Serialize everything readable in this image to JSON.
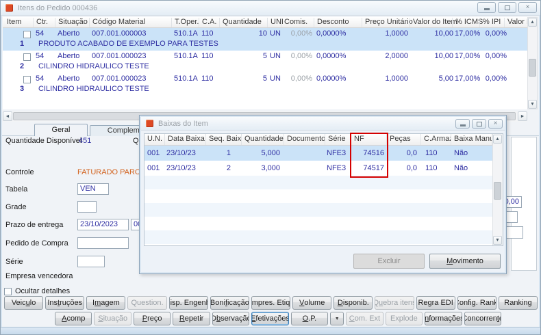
{
  "window": {
    "title": "Itens do Pedido 000436"
  },
  "icons": {
    "close": "×",
    "scroll_up": "▲",
    "scroll_down": "▼",
    "scroll_left": "◄",
    "scroll_right": "►",
    "dropdown": "▼"
  },
  "colors": {
    "row_highlight": "#cbe3f8",
    "nf_highlight_border": "#d40000",
    "status_orange": "#d2601a",
    "value_text": "#2e2ea2"
  },
  "grid": {
    "headers": {
      "item": "Item",
      "ctr": "Ctr.",
      "situacao": "Situação",
      "codigo": "Código Material",
      "toper": "T.Oper.",
      "ca": "C.A.",
      "quantidade": "Quantidade",
      "uni": "UNI",
      "comis": "Comis.",
      "desconto": "Desconto",
      "preco": "Preço Unitário",
      "valor": "Valor do Item",
      "icms": "% ICMS",
      "ipi": "% IPI",
      "valoripi": "Valor IPI"
    },
    "rows": [
      {
        "num": "1",
        "ctr": "54",
        "situacao": "Aberto",
        "codigo": "007.001.000003",
        "toper": "510.1A",
        "ca": "110",
        "qtd": "10",
        "uni": "UN",
        "comis": "0,00%",
        "desconto": "0,0000%",
        "preco": "1,0000",
        "valor": "10,00",
        "icms": "17,00%",
        "ipi": "0,00%",
        "desc": "PRODUTO ACABADO DE EXEMPLO PARA TESTES",
        "state": "selected"
      },
      {
        "num": "2",
        "ctr": "54",
        "situacao": "Aberto",
        "codigo": "007.001.000023",
        "toper": "510.1A",
        "ca": "110",
        "qtd": "5",
        "uni": "UN",
        "comis": "0,00%",
        "desconto": "0,0000%",
        "preco": "2,0000",
        "valor": "10,00",
        "icms": "17,00%",
        "ipi": "0,00%",
        "desc": "CILINDRO HIDRAULICO TESTE"
      },
      {
        "num": "3",
        "ctr": "54",
        "situacao": "Aberto",
        "codigo": "007.001.000023",
        "toper": "510.1A",
        "ca": "110",
        "qtd": "5",
        "uni": "UN",
        "comis": "0,00%",
        "desconto": "0,0000%",
        "preco": "1,0000",
        "valor": "5,00",
        "icms": "17,00%",
        "ipi": "0,00%",
        "desc": "CILINDRO HIDRAULICO TESTE"
      }
    ]
  },
  "tabs": {
    "geral": "Geral",
    "complemento": "Complemento"
  },
  "form": {
    "qtd_disponivel_label": "Quantidade Disponível",
    "qtd_disponivel_value": "451",
    "partial_label": "Q",
    "controle_label": "Controle",
    "controle_value": "FATURADO PARCIAL",
    "tabela_label": "Tabela",
    "tabela_value": "VEN",
    "grade_label": "Grade",
    "prazo_label": "Prazo de entrega",
    "prazo_value": "23/10/2023",
    "prazo_extra": "00",
    "pedido_label": "Pedido de Compra",
    "serie_label": "Série",
    "empresa_label": "Empresa vencedora",
    "right_value": "0,00"
  },
  "dialog": {
    "title": "Baixas do Item",
    "headers": {
      "un": "U.N.",
      "data": "Data Baixa",
      "seq": "Seq. Baixa",
      "qtd": "Quantidade",
      "doc": "Documento",
      "serie": "Série",
      "nf": "NF",
      "pecas": "Peças",
      "carmaz": "C.Armaz.",
      "manual": "Baixa Manual"
    },
    "rows": [
      {
        "un": "001",
        "data": "23/10/23",
        "seq": "1",
        "qtd": "5,000",
        "doc": "",
        "serie": "NFE3",
        "nf": "74516",
        "pecas": "0,0",
        "carmaz": "110",
        "manual": "Não",
        "state": "selected"
      },
      {
        "un": "001",
        "data": "23/10/23",
        "seq": "2",
        "qtd": "3,000",
        "doc": "",
        "serie": "NFE3",
        "nf": "74517",
        "pecas": "0,0",
        "carmaz": "110",
        "manual": "Não"
      }
    ],
    "buttons": [
      {
        "label": "Excluir",
        "cls": "disabled"
      },
      {
        "label": "Movimento",
        "accel": "M"
      }
    ]
  },
  "footer": {
    "ocultar_label": "Ocultar detalhes",
    "row1": [
      {
        "label": "Veiculo",
        "accel": "u"
      },
      {
        "label": "Instruções",
        "accel": "t"
      },
      {
        "label": "Imagem",
        "accel": "m"
      },
      {
        "label": "Question.",
        "cls": "disabled"
      },
      {
        "label": "Disp. Engenh."
      },
      {
        "label": "Bonificação",
        "accel": "f"
      },
      {
        "label": "Impres. Etiq.",
        "accel": "I"
      },
      {
        "label": "Volume",
        "accel": "V"
      },
      {
        "label": "Disponib.",
        "accel": "D"
      },
      {
        "label": "Quebra itens",
        "accel": "u",
        "cls": "disabled"
      },
      {
        "label": "Regra EDI"
      },
      {
        "label": "Config. Rank."
      },
      {
        "label": "Ranking"
      }
    ],
    "row2": [
      {
        "label": "Acomp",
        "accel": "A"
      },
      {
        "label": "Situação",
        "accel": "S",
        "cls": "disabled"
      },
      {
        "label": "Preço",
        "accel": "P"
      },
      {
        "label": "Repetir",
        "accel": "R"
      },
      {
        "label": "Observação",
        "accel": "b"
      },
      {
        "label": "Efetivações",
        "accel": "E",
        "cls": "focused"
      },
      {
        "label": "O.P.",
        "accel": "O"
      },
      {
        "label": "▼",
        "cls": "arrow"
      },
      {
        "label": "Com. Ext",
        "accel": "C",
        "cls": "disabled"
      },
      {
        "label": "Explode",
        "cls": "disabled"
      },
      {
        "label": "Informações",
        "accel": "n"
      },
      {
        "label": "Concorrente",
        "accel": "t"
      }
    ]
  }
}
